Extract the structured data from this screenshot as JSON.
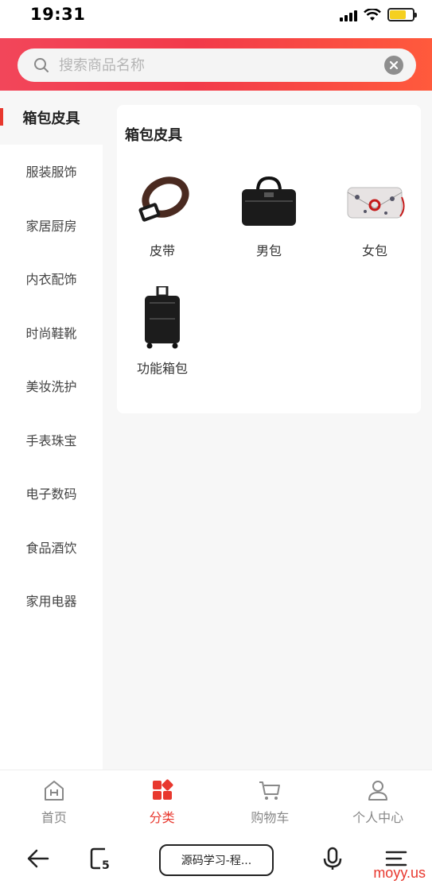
{
  "status": {
    "time": "19:31"
  },
  "search": {
    "placeholder": "搜索商品名称"
  },
  "sidebar": {
    "items": [
      {
        "label": "箱包皮具",
        "active": true
      },
      {
        "label": "服装服饰"
      },
      {
        "label": "家居厨房"
      },
      {
        "label": "内衣配饰"
      },
      {
        "label": "时尚鞋靴"
      },
      {
        "label": "美妆洗护"
      },
      {
        "label": "手表珠宝"
      },
      {
        "label": "电子数码"
      },
      {
        "label": "食品酒饮"
      },
      {
        "label": "家用电器"
      }
    ]
  },
  "content": {
    "title": "箱包皮具",
    "items": [
      {
        "label": "皮带",
        "icon": "belt-image"
      },
      {
        "label": "男包",
        "icon": "mens-bag-image"
      },
      {
        "label": "女包",
        "icon": "womens-bag-image"
      },
      {
        "label": "功能箱包",
        "icon": "luggage-image"
      }
    ]
  },
  "tabbar": {
    "tabs": [
      {
        "label": "首页",
        "icon": "home-icon"
      },
      {
        "label": "分类",
        "icon": "category-icon",
        "active": true
      },
      {
        "label": "购物车",
        "icon": "cart-icon"
      },
      {
        "label": "个人中心",
        "icon": "user-icon"
      }
    ]
  },
  "browser": {
    "url_label": "源码学习-程..."
  },
  "watermark": "moyy.us",
  "colors": {
    "accent": "#e8382e",
    "header_start": "#f2465a",
    "header_end": "#ff5a3c"
  }
}
